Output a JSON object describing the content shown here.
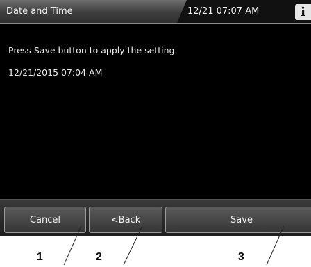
{
  "header": {
    "title": "Date and Time",
    "clock": "12/21 07:07 AM",
    "info_glyph": "i",
    "info_icon": "info-icon"
  },
  "main": {
    "message": "Press Save button to apply the setting.",
    "datetime_value": "12/21/2015 07:04 AM"
  },
  "footer": {
    "cancel_label": "Cancel",
    "back_label": "<Back",
    "save_label": "Save"
  },
  "callouts": [
    "1",
    "2",
    "3"
  ],
  "colors": {
    "screen_background": "#000000",
    "text": "#e8e8e8"
  }
}
